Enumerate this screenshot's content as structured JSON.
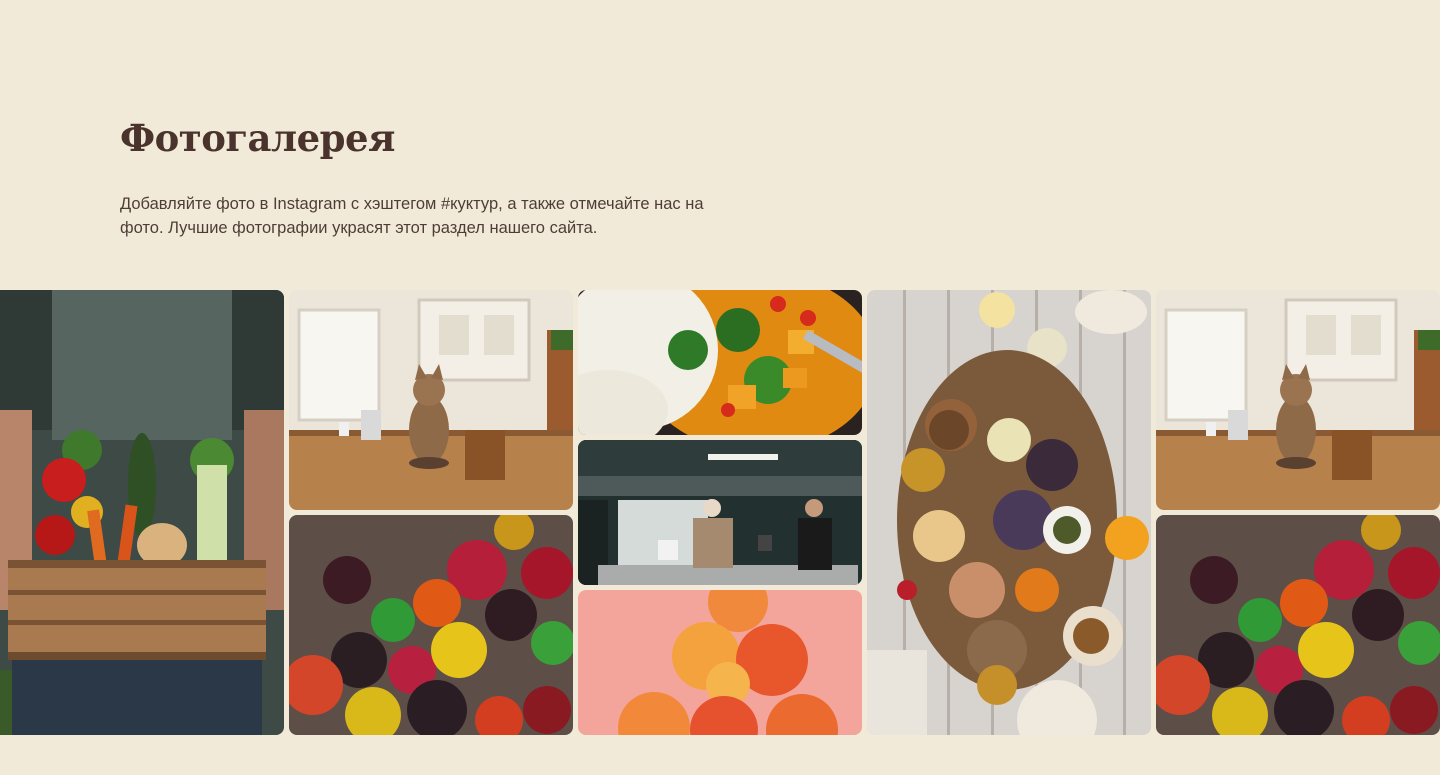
{
  "gallery": {
    "title": "Фотогалерея",
    "description": "Добавляйте фото в Instagram с хэштегом #куктур, а также отмечайте нас на фото. Лучшие фотографии украсят этот раздел нашего сайта."
  },
  "colors": {
    "background": "#f2ead8",
    "title": "#4a332c",
    "text": "#4e3d36"
  }
}
